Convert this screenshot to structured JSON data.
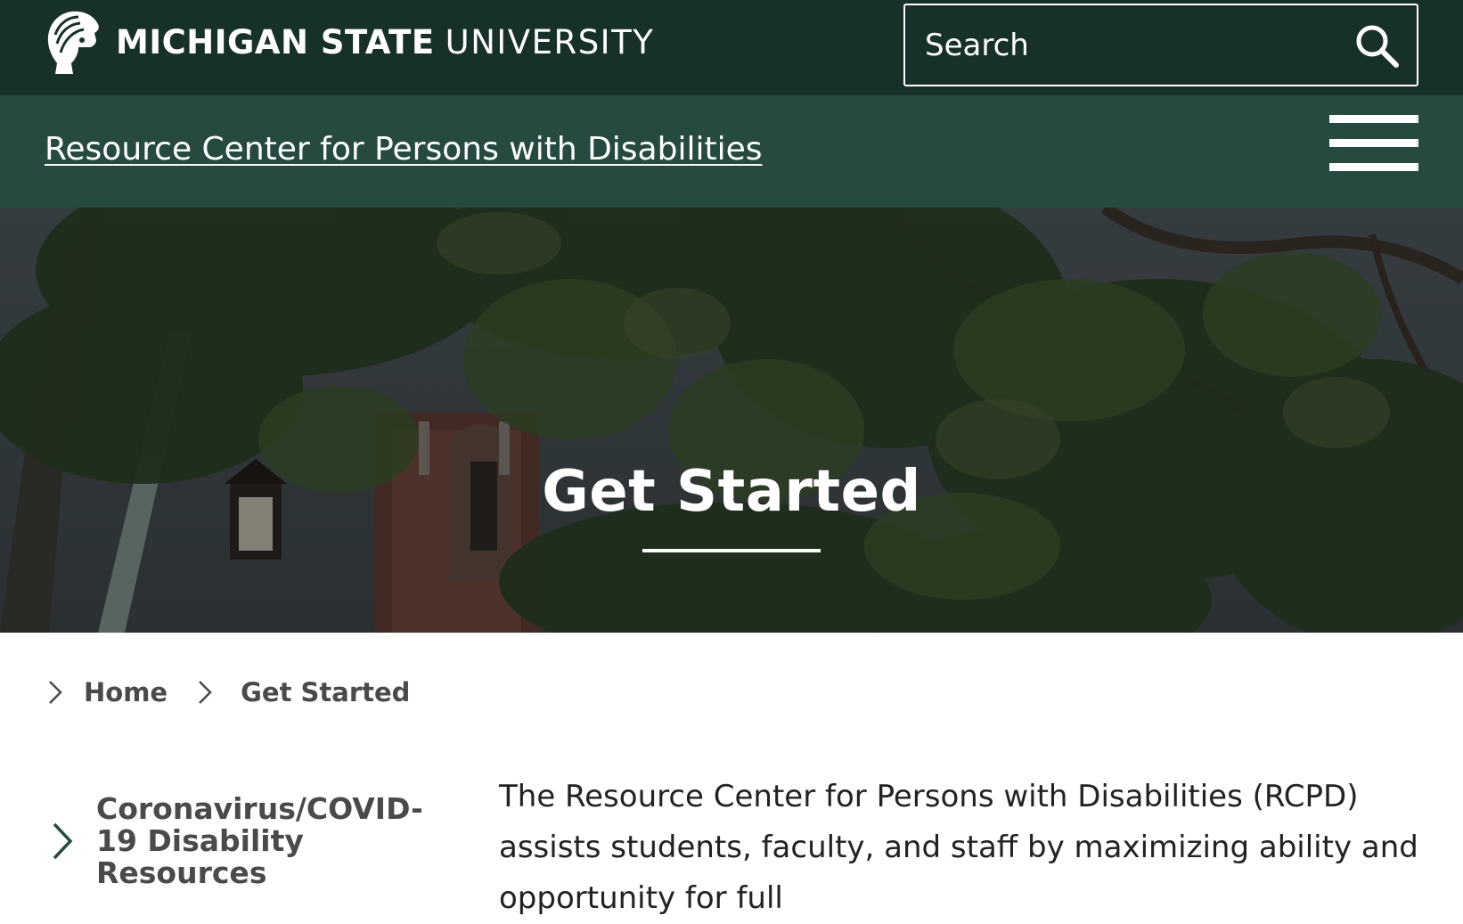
{
  "header": {
    "brand_bold": "MICHIGAN STATE",
    "brand_light": "UNIVERSITY",
    "logo_icon": "spartan-helmet-icon",
    "search": {
      "placeholder": "Search",
      "icon": "search-icon"
    }
  },
  "unit_bar": {
    "title": "Resource Center for Persons with Disabilities",
    "menu_icon": "hamburger-menu-icon"
  },
  "hero": {
    "title": "Get Started"
  },
  "breadcrumb": {
    "items": [
      {
        "label": "Home"
      },
      {
        "label": "Get Started"
      }
    ]
  },
  "side_nav": {
    "items": [
      {
        "label": "Coronavirus/COVID-19 Disability Resources"
      }
    ]
  },
  "content": {
    "intro": "The Resource Center for Persons with Disabilities (RCPD) assists students, faculty, and staff by maximizing ability and opportunity for full"
  },
  "colors": {
    "header_bg": "#18302a",
    "unit_bar_bg": "#264a3f",
    "text_gray": "#4a4a4a",
    "body_text": "#222222"
  }
}
